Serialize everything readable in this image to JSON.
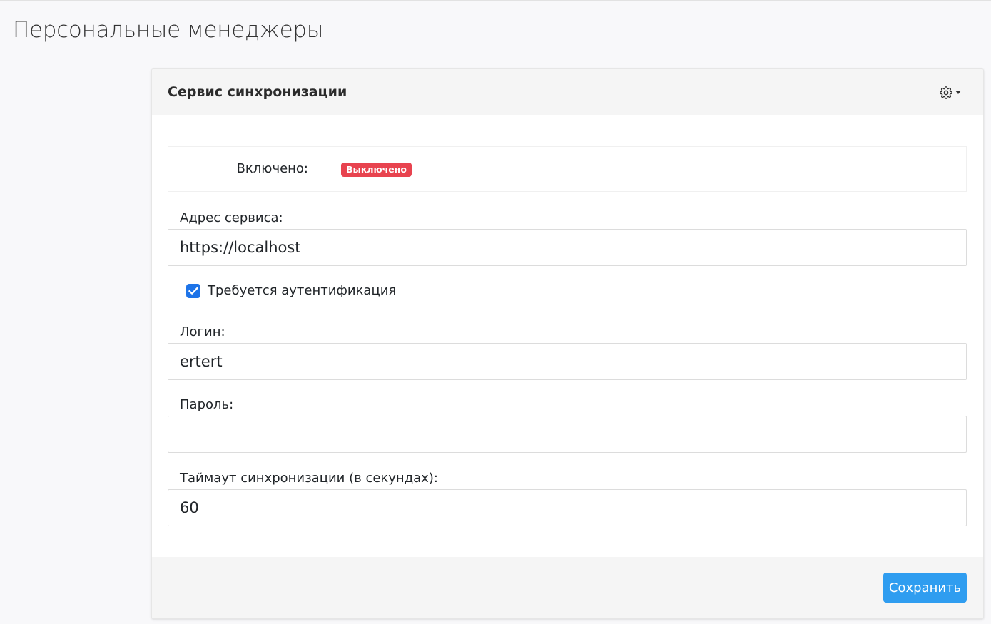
{
  "page": {
    "title": "Персональные менеджеры"
  },
  "card": {
    "title": "Сервис синхронизации",
    "settings_icon": "gear-icon",
    "status": {
      "label": "Включено:",
      "badge": "Выключено",
      "badge_color": "#e8434f"
    },
    "fields": {
      "service_address": {
        "label": "Адрес сервиса:",
        "value": "https://localhost"
      },
      "auth_required": {
        "label": "Требуется аутентификация",
        "checked": true
      },
      "login": {
        "label": "Логин:",
        "value": "ertert"
      },
      "password": {
        "label": "Пароль:",
        "value": ""
      },
      "timeout": {
        "label": "Таймаут синхронизации (в секундах):",
        "value": "60"
      }
    },
    "save_label": "Сохранить"
  },
  "colors": {
    "accent": "#2f9df0",
    "checkbox": "#1e74e8",
    "danger": "#e8434f"
  }
}
